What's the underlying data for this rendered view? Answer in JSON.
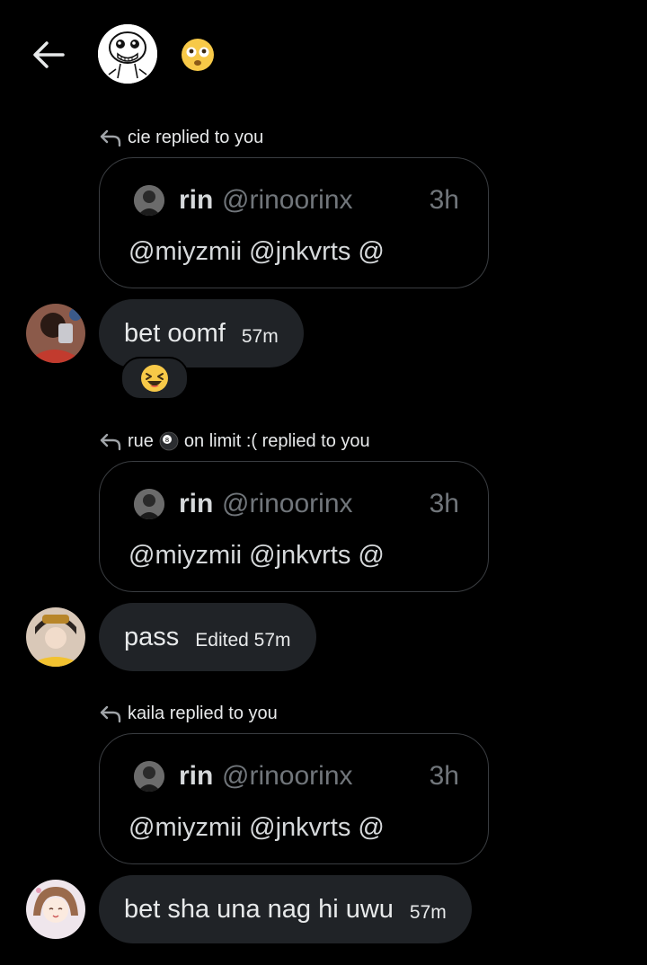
{
  "header": {
    "back_icon": "arrow-left-icon",
    "group_avatar": "meme-face-avatar",
    "emoji": "flushed-face-emoji"
  },
  "threads": [
    {
      "replier_label": "cie replied to you",
      "quote": {
        "name": "rin",
        "handle": "@rinoorinx",
        "time": "3h",
        "text": "@miyzmii @jnkvrts @"
      },
      "message": {
        "text": "bet oomf",
        "time": "57m"
      },
      "reaction": "laughing-squint-emoji"
    },
    {
      "replier_name": "rue",
      "replier_emoji": "8-ball-emoji",
      "replier_suffix": "on limit :( replied to you",
      "quote": {
        "name": "rin",
        "handle": "@rinoorinx",
        "time": "3h",
        "text": "@miyzmii @jnkvrts @"
      },
      "message": {
        "text": "pass",
        "time": "Edited 57m"
      }
    },
    {
      "replier_label": "kaila replied to you",
      "quote": {
        "name": "rin",
        "handle": "@rinoorinx",
        "time": "3h",
        "text": "@miyzmii @jnkvrts @"
      },
      "message": {
        "text": "bet sha una nag hi uwu",
        "time": "57m"
      }
    }
  ]
}
